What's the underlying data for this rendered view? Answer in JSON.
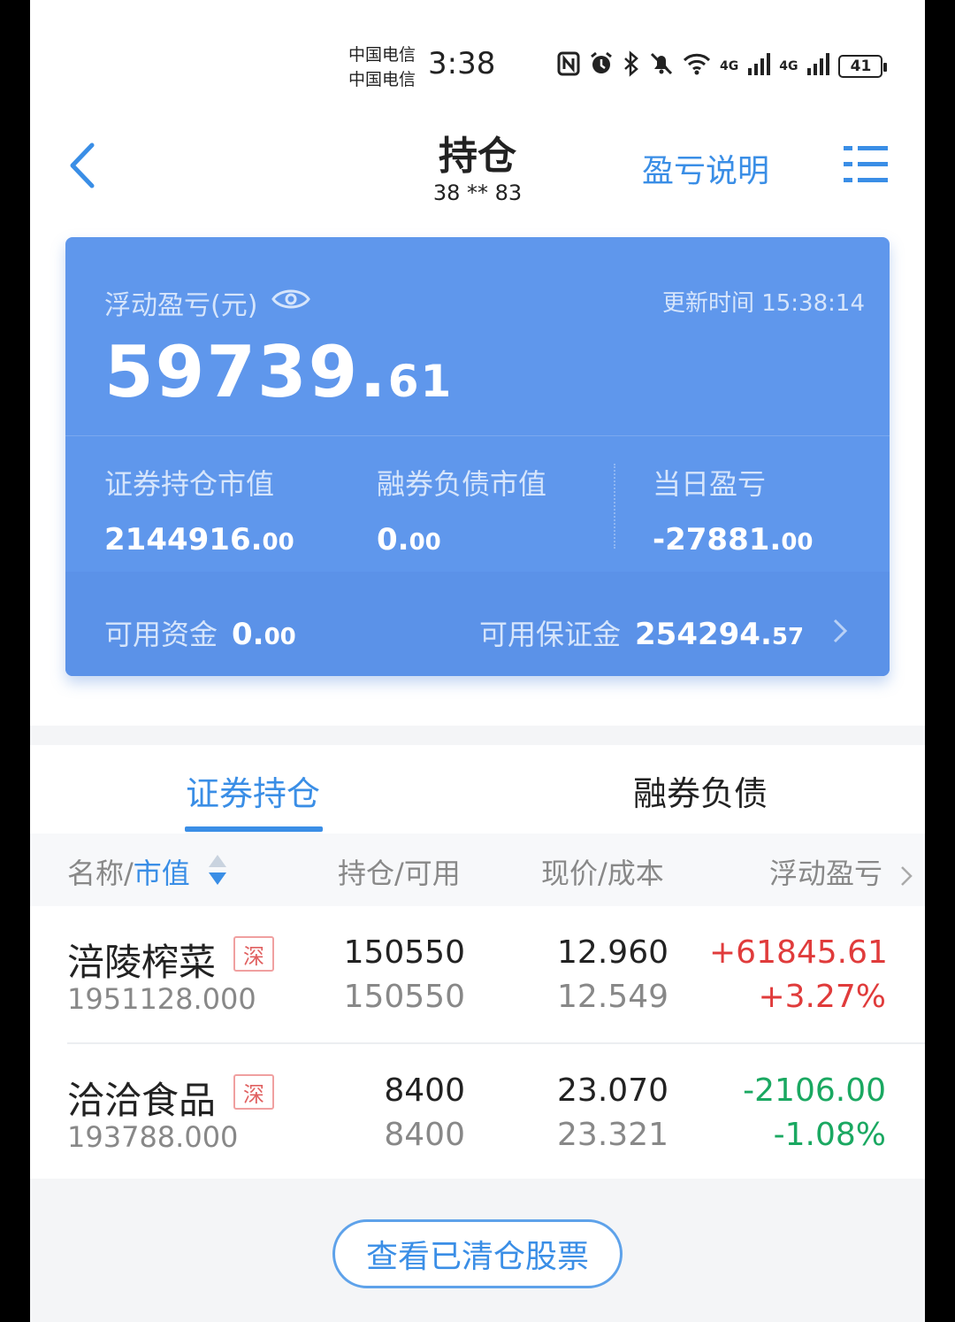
{
  "status_bar": {
    "carrier_1": "中国电信",
    "carrier_2": "中国电信",
    "time": "3:38",
    "network_1": "4G",
    "network_2": "4G",
    "battery": "41"
  },
  "header": {
    "title": "持仓",
    "account": "38 ** 83",
    "explain_link": "盈亏说明"
  },
  "summary": {
    "floating_pl_label": "浮动盈亏(元)",
    "update_time": "更新时间 15:38:14",
    "floating_pl_int": "59739.",
    "floating_pl_dec": "61",
    "metrics": [
      {
        "label": "证券持仓市值",
        "int": "2144916.",
        "dec": "00"
      },
      {
        "label": "融券负债市值",
        "int": "0.",
        "dec": "00"
      },
      {
        "label": "当日盈亏",
        "int": "-27881.",
        "dec": "00"
      }
    ],
    "available_funds_label": "可用资金",
    "available_funds_int": "0.",
    "available_funds_dec": "00",
    "available_margin_label": "可用保证金",
    "available_margin_int": "254294.",
    "available_margin_dec": "57"
  },
  "tabs": [
    {
      "label": "证券持仓",
      "active": true
    },
    {
      "label": "融券负债",
      "active": false
    }
  ],
  "table": {
    "col_name_a": "名称/",
    "col_name_b": "市值",
    "col_hold": "持仓/可用",
    "col_price": "现价/成本",
    "col_pl": "浮动盈亏",
    "rows": [
      {
        "name": "涪陵榨菜",
        "market": "深",
        "market_value": "1951128.000",
        "position": "150550",
        "available": "150550",
        "price": "12.960",
        "cost": "12.549",
        "pl": "+61845.61",
        "pl_pct": "+3.27%",
        "direction": "up"
      },
      {
        "name": "洽洽食品",
        "market": "深",
        "market_value": "193788.000",
        "position": "8400",
        "available": "8400",
        "price": "23.070",
        "cost": "23.321",
        "pl": "-2106.00",
        "pl_pct": "-1.08%",
        "direction": "down"
      }
    ]
  },
  "history_button": "查看已清仓股票",
  "colors": {
    "accent": "#3a8ee6",
    "card": "#5f97ec",
    "up": "#e03b3b",
    "down": "#1aa861"
  }
}
